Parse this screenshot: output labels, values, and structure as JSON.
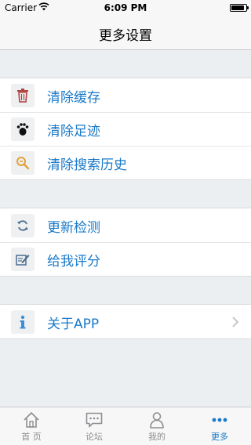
{
  "status_bar": {
    "carrier": "Carrier",
    "time": "6:09 PM",
    "battery_level": 0.9
  },
  "nav": {
    "title": "更多设置"
  },
  "groups": [
    {
      "items": [
        {
          "label": "清除缓存",
          "icon": "trash-icon",
          "icon_color": "#b0413e"
        },
        {
          "label": "清除足迹",
          "icon": "footprint-icon",
          "icon_color": "#111111"
        },
        {
          "label": "清除搜索历史",
          "icon": "search-clear-icon",
          "icon_color": "#e0a23a"
        }
      ]
    },
    {
      "items": [
        {
          "label": "更新检测",
          "icon": "refresh-icon",
          "icon_color": "#4a6d8c"
        },
        {
          "label": "给我评分",
          "icon": "rate-edit-icon",
          "icon_color": "#4a6d8c"
        }
      ]
    },
    {
      "items": [
        {
          "label": "关于APP",
          "icon": "info-icon",
          "icon_color": "#3b8fd6",
          "has_chevron": true
        }
      ]
    }
  ],
  "tabs": [
    {
      "label": "首 页",
      "icon": "home-icon",
      "active": false
    },
    {
      "label": "论坛",
      "icon": "forum-icon",
      "active": false
    },
    {
      "label": "我的",
      "icon": "profile-icon",
      "active": false
    },
    {
      "label": "更多",
      "icon": "more-icon",
      "active": true
    }
  ],
  "colors": {
    "accent": "#1a79c8",
    "inactive": "#8e8e93",
    "background": "#eceff1"
  }
}
